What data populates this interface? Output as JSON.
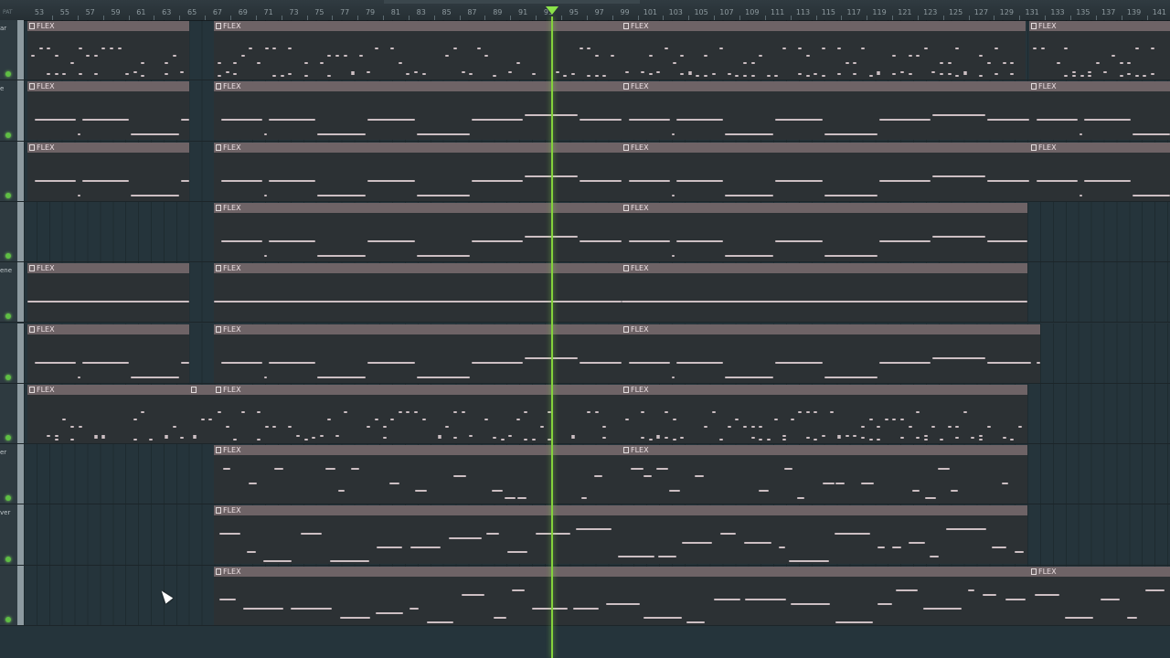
{
  "ruler": {
    "pat_label": "PAT",
    "bars": [
      "53",
      "55",
      "57",
      "59",
      "61",
      "63",
      "65",
      "67",
      "69",
      "71",
      "73",
      "75",
      "77",
      "79",
      "81",
      "83",
      "85",
      "87",
      "89",
      "91",
      "93",
      "95",
      "97",
      "99",
      "101",
      "103",
      "105",
      "107",
      "109",
      "111",
      "113",
      "115",
      "117",
      "119",
      "121",
      "123",
      "125",
      "127",
      "129",
      "131",
      "133",
      "135",
      "137",
      "139",
      "141"
    ]
  },
  "clip_label": "FLEX",
  "colors": {
    "background": "#25343b",
    "clip_header": "#6e6366",
    "clip_body": "#2c3134",
    "note": "#cdbfc3",
    "playhead": "#84d23c",
    "led": "#5fbf44"
  },
  "icons": {
    "playhead_marker": "triangle-down",
    "clip_icon": "pattern-box",
    "cursor": "arrow"
  },
  "tracks": [
    {
      "name": "ar",
      "style": "arp",
      "clips": []
    },
    {
      "name": "e",
      "style": "slow",
      "clips": []
    },
    {
      "name": "",
      "style": "slow",
      "clips": []
    },
    {
      "name": "",
      "style": "slow",
      "clips": []
    },
    {
      "name": "ene",
      "style": "held",
      "clips": []
    },
    {
      "name": "",
      "style": "slow",
      "clips": []
    },
    {
      "name": "",
      "style": "arp",
      "clips": []
    },
    {
      "name": "er",
      "style": "melody",
      "clips": []
    },
    {
      "name": "ver",
      "style": "lead",
      "clips": []
    },
    {
      "name": "",
      "style": "lead",
      "clips": []
    }
  ]
}
